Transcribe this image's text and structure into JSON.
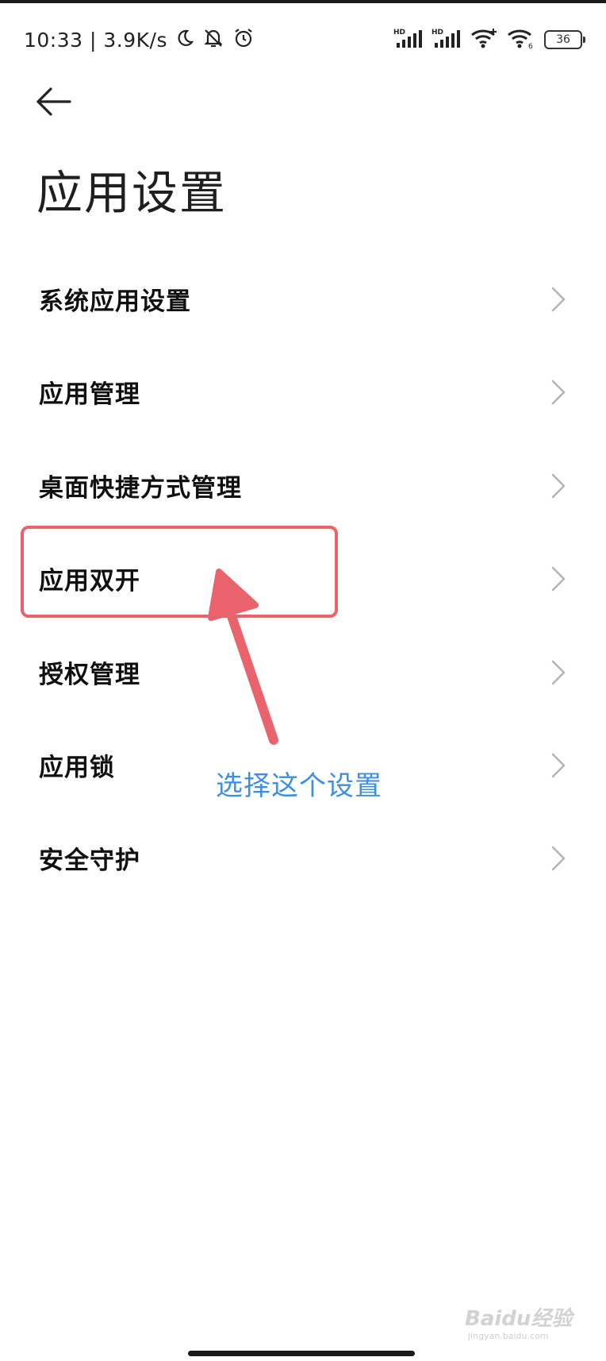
{
  "status_bar": {
    "time_speed": "10:33 | 3.9K/s",
    "hd1": "HD",
    "hd2": "HD",
    "battery": "36"
  },
  "header": {
    "back_icon": "arrow-left-icon",
    "title": "应用设置"
  },
  "menu": {
    "items": [
      {
        "label": "系统应用设置"
      },
      {
        "label": "应用管理"
      },
      {
        "label": "桌面快捷方式管理"
      },
      {
        "label": "应用双开"
      },
      {
        "label": "授权管理"
      },
      {
        "label": "应用锁"
      },
      {
        "label": "安全守护"
      }
    ]
  },
  "annotation": {
    "text": "选择这个设置",
    "color": "#e9636d"
  },
  "watermark": {
    "logo": "Baidu经验",
    "url": "jingyan.baidu.com"
  }
}
